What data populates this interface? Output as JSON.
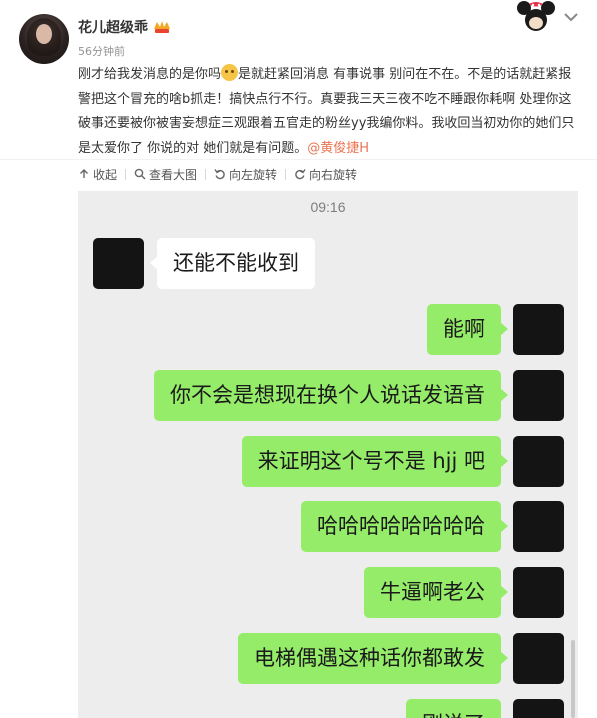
{
  "post": {
    "username": "花儿超级乖",
    "time_ago": "56分钟前",
    "text_part1": "刚才给我发消息的是你吗",
    "text_part2": "是就赶紧回消息 有事说事 别问在不在。不是的话就赶紧报警把这个冒充的啥b抓走！搞快点行不行。真要我三天三夜不吃不睡跟你耗啊 处理你这破事还要被你被害妄想症三观跟着五官走的粉丝yy我编你料。我收回当初劝你的她们只是太爱你了 你说的对 她们就是有问题。",
    "mention": "@黄俊捷H"
  },
  "toolbar": {
    "collapse_label": "收起",
    "view_large_label": "查看大图",
    "rotate_left_label": "向左旋转",
    "rotate_right_label": "向右旋转"
  },
  "chat": {
    "time": "09:16",
    "messages": [
      {
        "side": "left",
        "text": "还能不能收到"
      },
      {
        "side": "right",
        "text": "能啊"
      },
      {
        "side": "right",
        "text": "你不会是想现在换个人说话发语音"
      },
      {
        "side": "right",
        "text": "来证明这个号不是 hjj 吧"
      },
      {
        "side": "right",
        "text": "哈哈哈哈哈哈哈哈"
      },
      {
        "side": "right",
        "text": "牛逼啊老公"
      },
      {
        "side": "right",
        "text": "电梯偶遇这种话你都敢发"
      },
      {
        "side": "right",
        "text": "刚说了"
      }
    ]
  },
  "icons": {
    "collapse": "arrow-up-icon",
    "view_large": "magnifier-icon",
    "rotate_left": "rotate-left-icon",
    "rotate_right": "rotate-right-icon",
    "more": "chevron-down-icon"
  },
  "colors": {
    "mention": "#eb7350",
    "bubble_right": "#95ec69",
    "bubble_left": "#ffffff",
    "chat_bg": "#ededed"
  }
}
